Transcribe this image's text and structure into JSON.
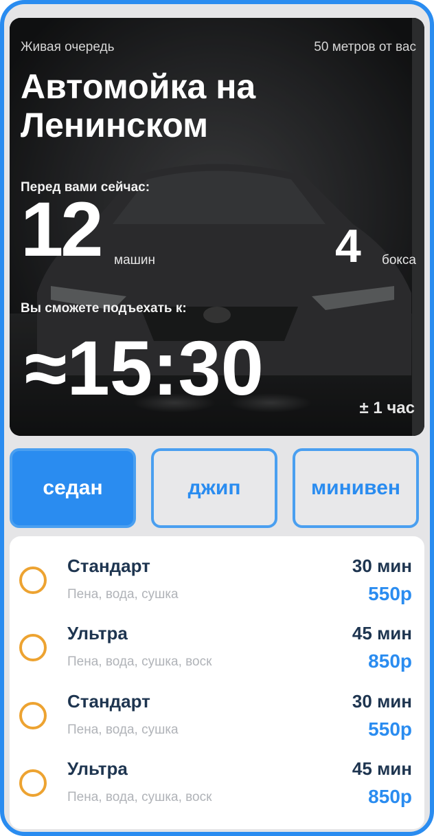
{
  "hero": {
    "queue_label": "Живая очередь",
    "distance_label": "50 метров от вас",
    "title": "Автомойка на Ленинском",
    "before_label": "Перед вами сейчас:",
    "cars_count": "12",
    "cars_unit": "машин",
    "boxes_count": "4",
    "boxes_unit": "бокса",
    "arrive_label": "Вы сможете подъехать к:",
    "eta": "≈15:30",
    "eta_range": "± 1 час"
  },
  "tabs": [
    {
      "label": "седан",
      "active": true
    },
    {
      "label": "джип",
      "active": false
    },
    {
      "label": "минивен",
      "active": false
    }
  ],
  "services": [
    {
      "name": "Стандарт",
      "desc": "Пена, вода, сушка",
      "time": "30 мин",
      "price": "550р"
    },
    {
      "name": "Ультра",
      "desc": "Пена, вода, сушка, воск",
      "time": "45 мин",
      "price": "850р"
    },
    {
      "name": "Стандарт",
      "desc": "Пена, вода, сушка",
      "time": "30 мин",
      "price": "550р"
    },
    {
      "name": "Ультра",
      "desc": "Пена, вода, сушка, воск",
      "time": "45 мин",
      "price": "850р"
    }
  ],
  "colors": {
    "accent": "#2a8cf0",
    "radio": "#eda331",
    "text_dark": "#1e3550",
    "text_muted": "#b0b3b8"
  }
}
